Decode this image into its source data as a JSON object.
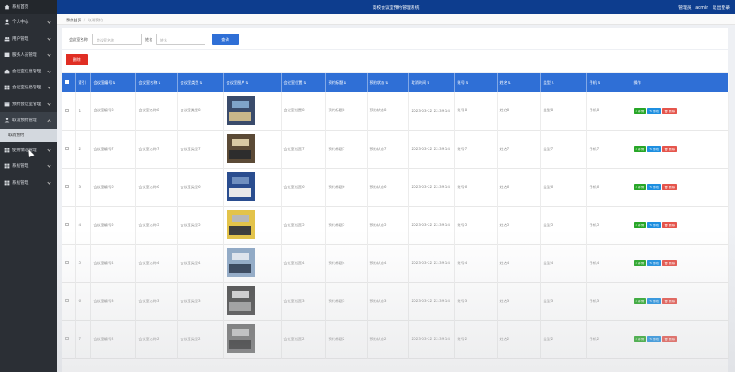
{
  "app": {
    "title": "高校会议室预约管理系统"
  },
  "user": {
    "role": "管理员",
    "name": "admin",
    "logout": "退出登录"
  },
  "sidebar": {
    "items": [
      {
        "label": "系统首页",
        "icon": "home-icon"
      },
      {
        "label": "个人中心",
        "icon": "person-icon"
      },
      {
        "label": "用户管理",
        "icon": "users-icon"
      },
      {
        "label": "服务人员管理",
        "icon": "staff-icon"
      },
      {
        "label": "会议室信息管理",
        "icon": "room-icon"
      },
      {
        "label": "会议室信息管理",
        "icon": "grid-icon"
      },
      {
        "label": "预约会议室管理",
        "icon": "calendar-icon"
      },
      {
        "label": "取消预约管理",
        "icon": "cancel-icon"
      },
      {
        "label": "取消预约",
        "icon": ""
      },
      {
        "label": "使用情况管理",
        "icon": "grid-icon"
      },
      {
        "label": "系统管理",
        "icon": "settings-icon"
      },
      {
        "label": "系统管理",
        "icon": "settings-icon"
      }
    ]
  },
  "breadcrumb": {
    "home": "系统首页",
    "current": "取消预约"
  },
  "search": {
    "room_label": "会议室名称",
    "room_placeholder": "会议室名称",
    "name_label": "姓名",
    "name_placeholder": "姓名",
    "button": "查询"
  },
  "delete_button": "删除",
  "table": {
    "columns": [
      "索引",
      "会议室编号",
      "会议室名称",
      "会议室类型",
      "会议室图片",
      "会议室位置",
      "预约标题",
      "预约状态",
      "取消时间",
      "账号",
      "姓名",
      "类型",
      "手机",
      "操作"
    ],
    "actions": {
      "detail": "详情",
      "edit": "修改",
      "delete": "删除"
    },
    "rows": [
      {
        "index": "1",
        "room_no": "会议室编号8",
        "room_name": "会议室名称8",
        "room_type": "会议室类型8",
        "room_loc": "会议室位置8",
        "title": "预约标题8",
        "status": "预约状态8",
        "cancel_time": "2023-03-22 22:39:14",
        "account": "账号8",
        "name": "姓名8",
        "type": "类型8",
        "phone": "手机8"
      },
      {
        "index": "2",
        "room_no": "会议室编号7",
        "room_name": "会议室名称7",
        "room_type": "会议室类型7",
        "room_loc": "会议室位置7",
        "title": "预约标题7",
        "status": "预约状态7",
        "cancel_time": "2023-03-22 22:39:14",
        "account": "账号7",
        "name": "姓名7",
        "type": "类型7",
        "phone": "手机7"
      },
      {
        "index": "3",
        "room_no": "会议室编号6",
        "room_name": "会议室名称6",
        "room_type": "会议室类型6",
        "room_loc": "会议室位置6",
        "title": "预约标题6",
        "status": "预约状态6",
        "cancel_time": "2023-03-22 22:39:14",
        "account": "账号6",
        "name": "姓名6",
        "type": "类型6",
        "phone": "手机6"
      },
      {
        "index": "4",
        "room_no": "会议室编号5",
        "room_name": "会议室名称5",
        "room_type": "会议室类型5",
        "room_loc": "会议室位置5",
        "title": "预约标题5",
        "status": "预约状态5",
        "cancel_time": "2023-03-22 22:39:14",
        "account": "账号5",
        "name": "姓名5",
        "type": "类型5",
        "phone": "手机5"
      },
      {
        "index": "5",
        "room_no": "会议室编号4",
        "room_name": "会议室名称4",
        "room_type": "会议室类型4",
        "room_loc": "会议室位置4",
        "title": "预约标题4",
        "status": "预约状态4",
        "cancel_time": "2023-03-22 22:39:14",
        "account": "账号4",
        "name": "姓名4",
        "type": "类型4",
        "phone": "手机4"
      },
      {
        "index": "6",
        "room_no": "会议室编号3",
        "room_name": "会议室名称3",
        "room_type": "会议室类型3",
        "room_loc": "会议室位置3",
        "title": "预约标题3",
        "status": "预约状态3",
        "cancel_time": "2023-03-22 22:39:14",
        "account": "账号3",
        "name": "姓名3",
        "type": "类型3",
        "phone": "手机3"
      },
      {
        "index": "7",
        "room_no": "会议室编号2",
        "room_name": "会议室名称2",
        "room_type": "会议室类型2",
        "room_loc": "会议室位置2",
        "title": "预约标题2",
        "status": "预约状态2",
        "cancel_time": "2023-03-22 22:39:14",
        "account": "账号2",
        "name": "姓名2",
        "type": "类型2",
        "phone": "手机2"
      }
    ]
  },
  "colors": {
    "header": "#0d3d8e",
    "table_head": "#2f6fd6",
    "sidebar": "#2b2f35",
    "delete": "#e02e24",
    "detail": "#27a627",
    "edit": "#1e8fe0",
    "remove": "#e5554c"
  }
}
